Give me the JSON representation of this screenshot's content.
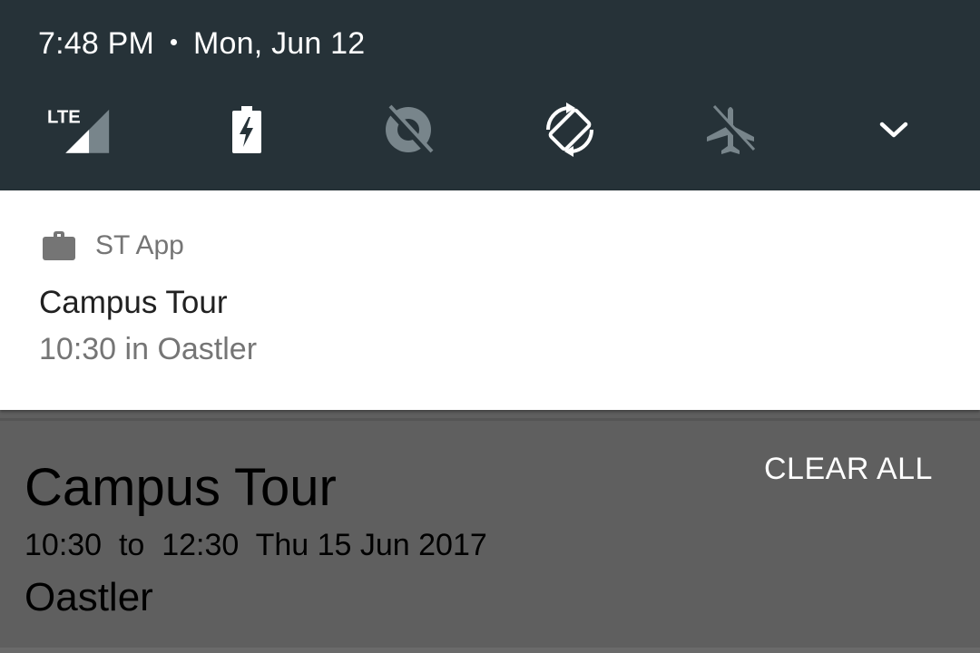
{
  "status_bar": {
    "time": "7:48 PM",
    "date": "Mon, Jun 12"
  },
  "quick_settings": {
    "tiles": [
      {
        "name": "lte-signal-icon",
        "label": "LTE",
        "state": "active"
      },
      {
        "name": "battery-charging-icon",
        "state": "active"
      },
      {
        "name": "data-saver-off-icon",
        "state": "inactive"
      },
      {
        "name": "auto-rotate-icon",
        "state": "active"
      },
      {
        "name": "airplane-mode-icon",
        "state": "inactive"
      },
      {
        "name": "expand-chevron-icon",
        "state": "active"
      }
    ]
  },
  "notification": {
    "app_name": "ST App",
    "title": "Campus Tour",
    "text": "10:30 in Oastler"
  },
  "actions": {
    "clear_all": "CLEAR ALL"
  },
  "app_content": {
    "event_title": "Campus Tour",
    "event_time": "10:30  to  12:30  Thu 15 Jun 2017",
    "event_location": "Oastler"
  },
  "colors": {
    "shade_bg": "#263238",
    "notification_bg": "#ffffff",
    "scrim_bg": "#5f5f5f",
    "inactive_icon": "#78858b"
  }
}
